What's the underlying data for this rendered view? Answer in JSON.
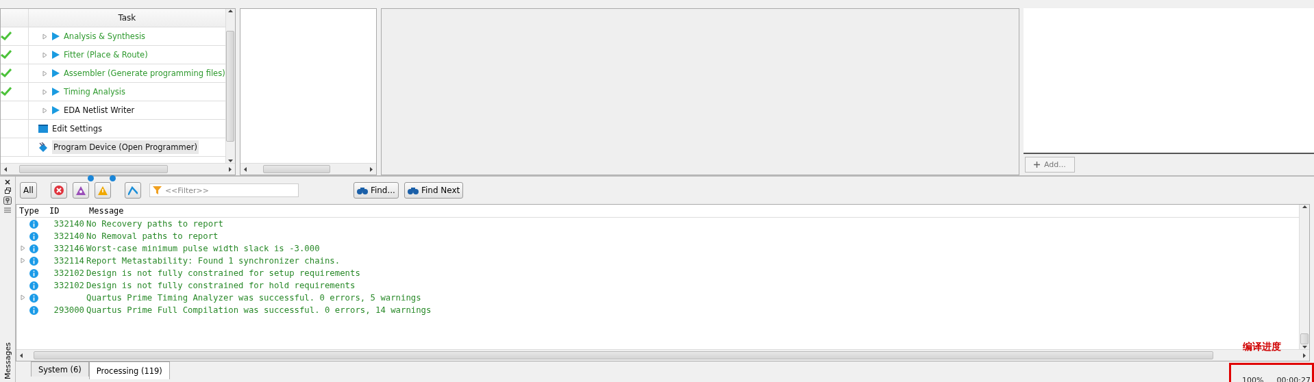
{
  "task_panel": {
    "header": "Task",
    "rows": [
      {
        "kind": "stage",
        "label": "Analysis & Synthesis",
        "done": true
      },
      {
        "kind": "stage",
        "label": "Fitter (Place & Route)",
        "done": true
      },
      {
        "kind": "stage",
        "label": "Assembler (Generate programming files)",
        "done": true
      },
      {
        "kind": "stage",
        "label": "Timing Analysis",
        "done": true
      },
      {
        "kind": "stage",
        "label": "EDA Netlist Writer",
        "done": false
      },
      {
        "kind": "settings",
        "label": "Edit Settings",
        "done": false
      },
      {
        "kind": "program",
        "label": "Program Device (Open Programmer)",
        "done": false
      }
    ]
  },
  "add_button": "Add...",
  "messages": {
    "all_button": "All",
    "filter_placeholder": "<<Filter>>",
    "find_button": "Find...",
    "find_next_button": "Find Next",
    "columns": [
      "Type",
      "ID",
      "Message"
    ],
    "rows": [
      {
        "id": "332140",
        "message": "No Recovery paths to report",
        "expandable": false
      },
      {
        "id": "332140",
        "message": "No Removal paths to report",
        "expandable": false
      },
      {
        "id": "332146",
        "message": "Worst-case minimum pulse width slack is -3.000",
        "expandable": true
      },
      {
        "id": "332114",
        "message": "Report Metastability: Found 1 synchronizer chains.",
        "expandable": true
      },
      {
        "id": "332102",
        "message": "Design is not fully constrained for setup requirements",
        "expandable": false
      },
      {
        "id": "332102",
        "message": "Design is not fully constrained for hold requirements",
        "expandable": false
      },
      {
        "id": "",
        "message": "Quartus Prime Timing Analyzer was successful. 0 errors, 5 warnings",
        "expandable": true
      },
      {
        "id": "293000",
        "message": "Quartus Prime Full Compilation was successful. 0 errors, 14 warnings",
        "expandable": false
      }
    ],
    "side_label": "Messages",
    "tabs": [
      {
        "label": "System (6)",
        "selected": false
      },
      {
        "label": "Processing (119)",
        "selected": true
      }
    ]
  },
  "annotation": "编译进度",
  "status": {
    "progress": "100%",
    "time": "00:00:27"
  }
}
